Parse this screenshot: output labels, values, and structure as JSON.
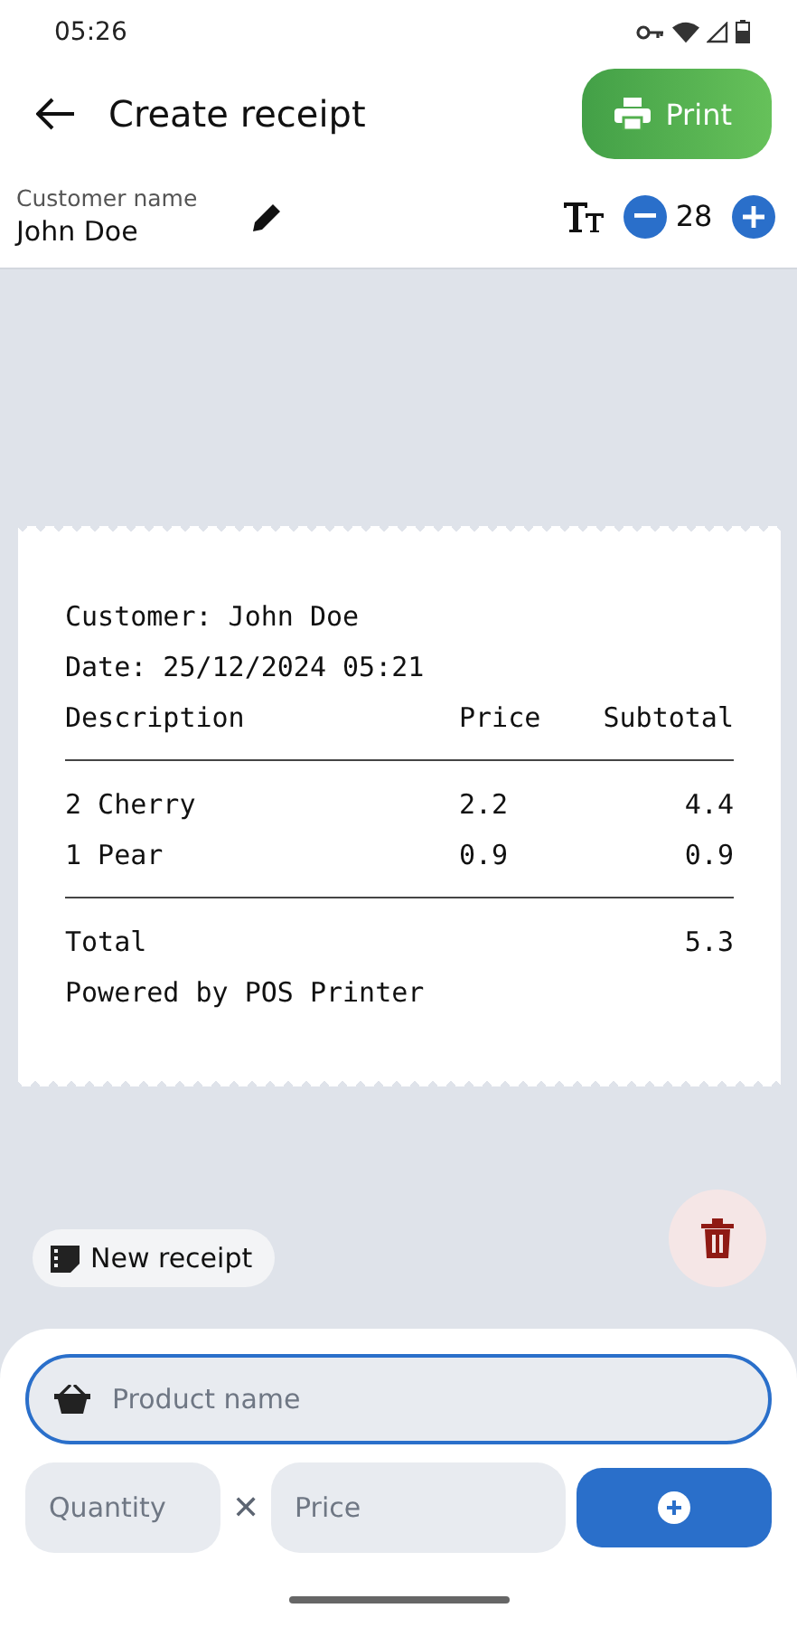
{
  "status_bar": {
    "time": "05:26"
  },
  "app_bar": {
    "title": "Create receipt",
    "print_button": "Print"
  },
  "customer": {
    "label": "Customer name",
    "value": "John Doe"
  },
  "font_size": {
    "value": "28"
  },
  "receipt": {
    "customer_line": "Customer: John Doe",
    "date_line": "Date: 25/12/2024 05:21",
    "columns": [
      "Description",
      "Price",
      "Subtotal"
    ],
    "rows": [
      {
        "description": "2 Cherry",
        "price": "2.2",
        "subtotal": "4.4"
      },
      {
        "description": "1 Pear",
        "price": "0.9",
        "subtotal": "0.9"
      }
    ],
    "total_label": "Total",
    "total_value": "5.3",
    "footer": "Powered by POS Printer"
  },
  "new_receipt_button": "New receipt",
  "form": {
    "product": {
      "placeholder": "Product name",
      "focused": true
    },
    "quantity": {
      "placeholder": "Quantity"
    },
    "times_sign": "✕",
    "price": {
      "placeholder": "Price"
    }
  }
}
